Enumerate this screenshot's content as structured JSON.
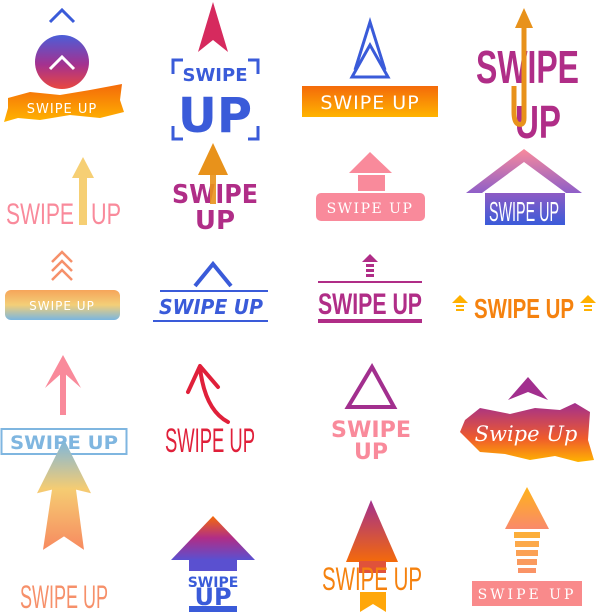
{
  "labels": {
    "t1": "SWIPE UP",
    "t2_top": "SWIPE",
    "t2_bottom": "UP",
    "t3": "SWIPE UP",
    "t4_top": "SWIPE",
    "t4_bottom": "UP",
    "t5_left": "SWIPE",
    "t5_right": "UP",
    "t6_top": "SWIPE",
    "t6_bottom": "UP",
    "t7": "SWIPE UP",
    "t8": "SWIPE UP",
    "t9": "SWIPE UP",
    "t10": "SWIPE UP",
    "t11": "SWIPE UP",
    "t12": "SWIPE UP",
    "t13": "SWIPE UP",
    "t14": "SWIPE UP",
    "t15_top": "SWIPE",
    "t15_bottom": "UP",
    "t16": "Swipe Up",
    "t17": "SWIPE UP",
    "t18_top": "SWIPE",
    "t18_bottom": "UP",
    "t19": "SWIPE UP",
    "t20": "SWIPE UP"
  },
  "colors": {
    "blue": "#3a5bd9",
    "purple": "#b02d87",
    "pink": "#f98a9b",
    "orange": "#f5820f",
    "yellow": "#f6cf74",
    "red": "#e0203a",
    "light_blue": "#7fb6e0"
  }
}
